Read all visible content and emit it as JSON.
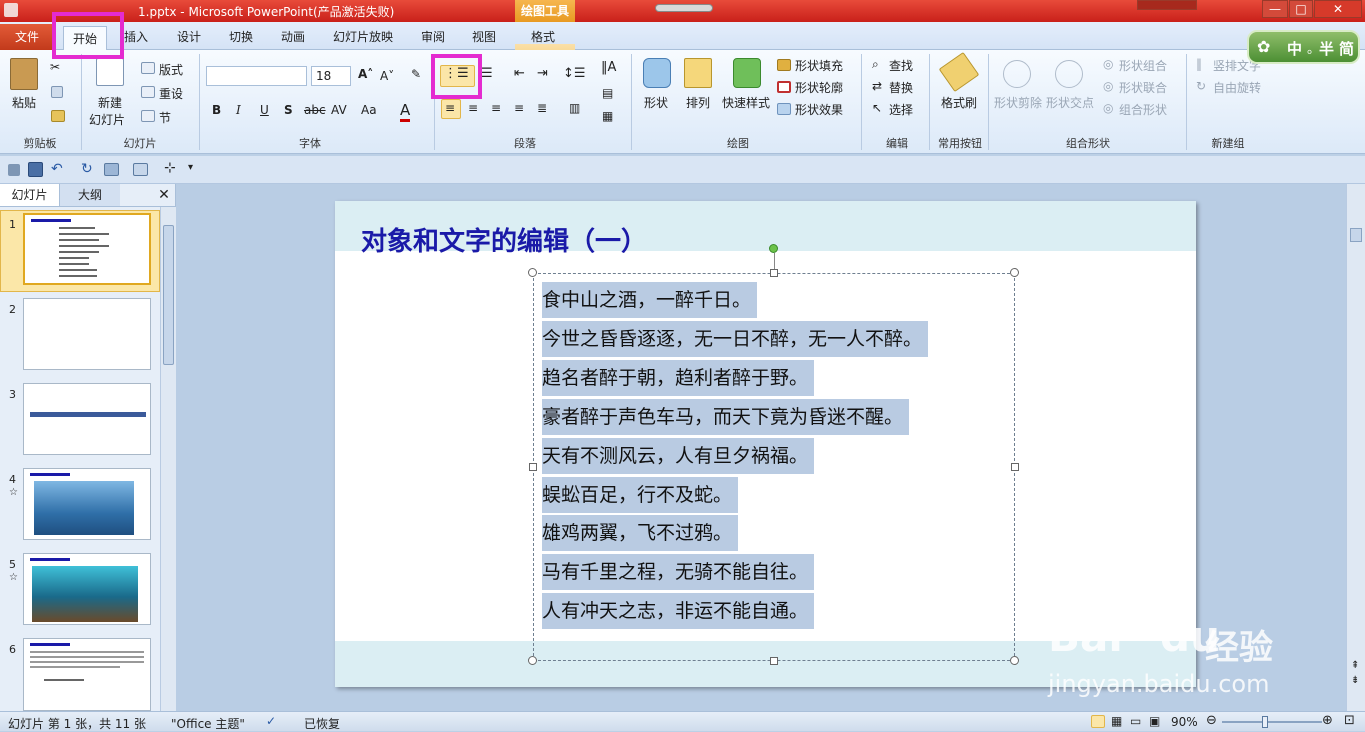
{
  "window": {
    "title": "1.pptx - Microsoft PowerPoint(产品激活失败)",
    "context_tool": "绘图工具",
    "min_label": "—",
    "max_label": "□",
    "close_label": "✕"
  },
  "tabs": {
    "file": "文件",
    "home": "开始",
    "insert": "插入",
    "design": "设计",
    "transitions": "切换",
    "animations": "动画",
    "slideshow": "幻灯片放映",
    "review": "审阅",
    "view": "视图",
    "format": "格式"
  },
  "ribbon": {
    "clipboard": {
      "paste": "粘贴",
      "label": "剪贴板"
    },
    "slides": {
      "new_slide_1": "新建",
      "new_slide_2": "幻灯片",
      "layout": "版式",
      "reset": "重设",
      "section": "节",
      "label": "幻灯片"
    },
    "font": {
      "size": "18",
      "bold": "B",
      "italic": "I",
      "underline": "U",
      "shadow": "S",
      "strike": "abc",
      "label": "字体"
    },
    "paragraph": {
      "label": "段落"
    },
    "drawing": {
      "shapes": "形状",
      "arrange": "排列",
      "quick_styles": "快速样式",
      "fill": "形状填充",
      "outline": "形状轮廓",
      "effects": "形状效果",
      "label": "绘图"
    },
    "editing": {
      "find": "查找",
      "replace": "替换",
      "select": "选择",
      "label": "编辑"
    },
    "common": {
      "format_painter": "格式刷",
      "label": "常用按钮"
    },
    "combine": {
      "shape_cut": "形状剪除",
      "shape_intersect": "形状交点",
      "shape_combine": "形状组合",
      "shape_union": "形状联合",
      "combine_shapes": "组合形状",
      "label": "组合形状"
    },
    "newgroup": {
      "vertical_text": "竖排文字",
      "free_rotate": "自由旋转",
      "label": "新建组"
    }
  },
  "ime": {
    "label": "中",
    "dot": "。",
    "mode": "半",
    "mode2": "简"
  },
  "panel": {
    "tab_slides": "幻灯片",
    "tab_outline": "大纲",
    "close": "✕",
    "slides": [
      {
        "num": "1"
      },
      {
        "num": "2"
      },
      {
        "num": "3"
      },
      {
        "num": "4",
        "star": "☆"
      },
      {
        "num": "5",
        "star": "☆"
      },
      {
        "num": "6"
      }
    ]
  },
  "slide": {
    "title": "对象和文字的编辑（一）",
    "lines": [
      " 食中山之酒，一醉千日。",
      "今世之昏昏逐逐，无一日不醉，无一人不醉。",
      "趋名者醉于朝，趋利者醉于野。",
      "豪者醉于声色车马，而天下竟为昏迷不醒。",
      "天有不测风云，人有旦夕祸福。",
      "蜈蚣百足，行不及蛇。",
      "雄鸡两翼，飞不过鸦。",
      "马有千里之程，无骑不能自往。",
      "人有冲天之志，非运不能自通。"
    ]
  },
  "status": {
    "slide_info": "幻灯片 第 1 张，共 11 张",
    "theme": "\"Office 主题\"",
    "recovered": "已恢复",
    "zoom": "90%"
  },
  "watermark": {
    "brand": "Bai",
    "brand2": "du",
    "jingyan": "经验",
    "url": "jingyan.baidu.com"
  },
  "colors": {
    "highlight": "#e42bd0",
    "title_text": "#1a1aa8",
    "selection": "#b9cbe2",
    "file_tab": "#c23a1b"
  }
}
